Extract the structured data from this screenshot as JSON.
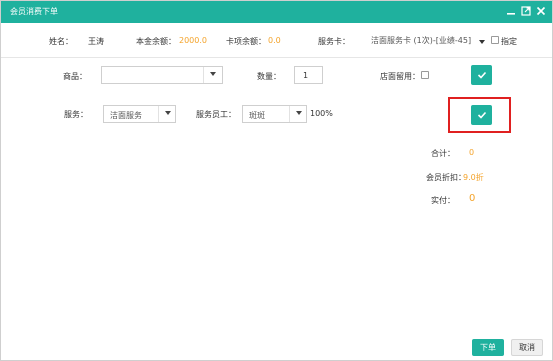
{
  "window": {
    "title": "会员消费下单",
    "controls": [
      "minimize-icon",
      "restore-icon",
      "close-icon"
    ]
  },
  "member": {
    "name_label": "姓名：",
    "name_value": "王涛",
    "balance_label": "本金余额：",
    "balance_value": "2000.0",
    "card_balance_label": "卡项余额：",
    "card_balance_value": "0.0",
    "card_label": "服务卡：",
    "card_value": "洁面服务卡 (1次)-[业绩-45]",
    "designate_label": "指定"
  },
  "order": {
    "product_label": "商品：",
    "product_value": "",
    "quantity_label": "数量：",
    "quantity_value": "1",
    "store_use_label": "店面留用：",
    "service_label": "服务：",
    "service_value": "洁面服务",
    "staff_label": "服务员工：",
    "staff_value": "斑斑",
    "percent_value": "100%"
  },
  "summary": {
    "total_label": "合计：",
    "total_value": "0",
    "discount_label": "会员折扣：",
    "discount_value": "9.0折",
    "paid_label": "实付：",
    "paid_value": "0"
  },
  "footer": {
    "submit_label": "下单",
    "cancel_label": "取消"
  },
  "colors": {
    "accent": "#1fb19e",
    "highlight": "#e02020",
    "value": "#f4a32a"
  }
}
